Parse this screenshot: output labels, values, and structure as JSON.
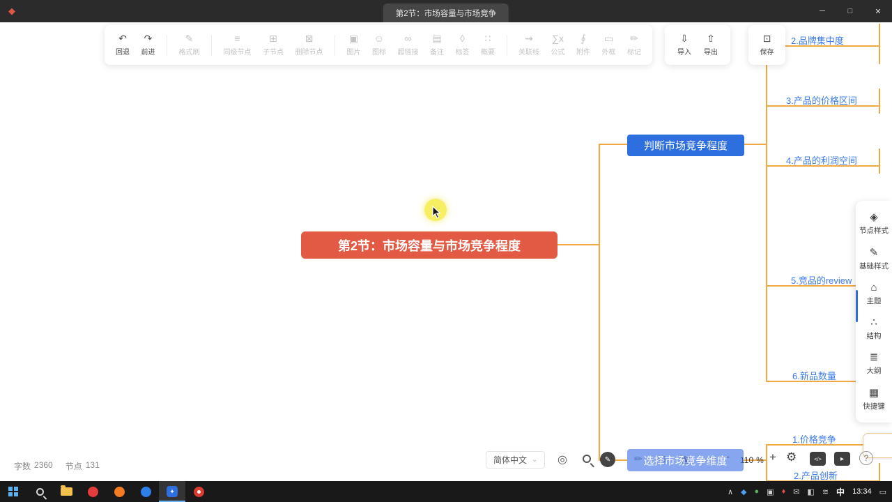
{
  "titlebar": {
    "title": "第2节：市场容量与市场竞争",
    "logo_glyph": "◆",
    "minimize": "─",
    "maximize": "□",
    "close": "✕"
  },
  "toolbar": {
    "tools": [
      {
        "label": "回退",
        "icon": "↶"
      },
      {
        "label": "前进",
        "icon": "↷"
      },
      {
        "label": "格式刷",
        "icon": "✎"
      },
      {
        "label": "同级节点",
        "icon": "≡"
      },
      {
        "label": "子节点",
        "icon": "⊞"
      },
      {
        "label": "删除节点",
        "icon": "⊠"
      },
      {
        "label": "图片",
        "icon": "▣"
      },
      {
        "label": "图标",
        "icon": "☺"
      },
      {
        "label": "超链接",
        "icon": "∞"
      },
      {
        "label": "备注",
        "icon": "▤"
      },
      {
        "label": "标签",
        "icon": "◊"
      },
      {
        "label": "概要",
        "icon": "∷"
      },
      {
        "label": "关联线",
        "icon": "⇝"
      },
      {
        "label": "公式",
        "icon": "∑x"
      },
      {
        "label": "附件",
        "icon": "∮"
      },
      {
        "label": "外框",
        "icon": "▭"
      },
      {
        "label": "标记",
        "icon": "✏"
      }
    ],
    "io": [
      {
        "label": "导入",
        "icon": "⇩"
      },
      {
        "label": "导出",
        "icon": "⇧"
      }
    ],
    "save": {
      "label": "保存",
      "icon": "⊡"
    }
  },
  "mindmap": {
    "central": "第2节：市场容量与市场竞争程度",
    "judge": "判断市场竞争程度",
    "select": "选择市场竞争维度",
    "right": [
      "2.品牌集中度",
      "3.产品的价格区间",
      "4.产品的利润空间",
      "5.竞品的review",
      "6.新品数量"
    ],
    "bottom": [
      "1.价格竞争",
      "2.产品创新"
    ],
    "colors": {
      "line": "#f0a843",
      "central_node": "#e25a44",
      "branch_node": "#2e6fe0",
      "label_text": "#3b7ce8"
    }
  },
  "sidebar": {
    "items": [
      {
        "label": "节点样式",
        "icon": "◈"
      },
      {
        "label": "基础样式",
        "icon": "✎"
      },
      {
        "label": "主题",
        "icon": "⌂"
      },
      {
        "label": "结构",
        "icon": "∴"
      },
      {
        "label": "大纲",
        "icon": "≣"
      },
      {
        "label": "快捷键",
        "icon": "▦"
      }
    ]
  },
  "bottom": {
    "words_label": "字数",
    "words": "2360",
    "nodes_label": "节点",
    "nodes": "131",
    "language": "简体中文",
    "caret": "⌄",
    "icons": {
      "locate": "◎",
      "pen": "✎",
      "annotate": "✏",
      "crop": "⊡",
      "image": "▣",
      "settings": "⚙"
    },
    "zoom_out": "−",
    "zoom_level": "110",
    "zoom_unit": "%",
    "zoom_in": "+",
    "embed": "</>",
    "present": "▸",
    "help": "?"
  },
  "taskbar": {
    "chevron": "∧",
    "app_glyph": "✦",
    "ime": "中",
    "time": "13:34",
    "action": "▭"
  }
}
